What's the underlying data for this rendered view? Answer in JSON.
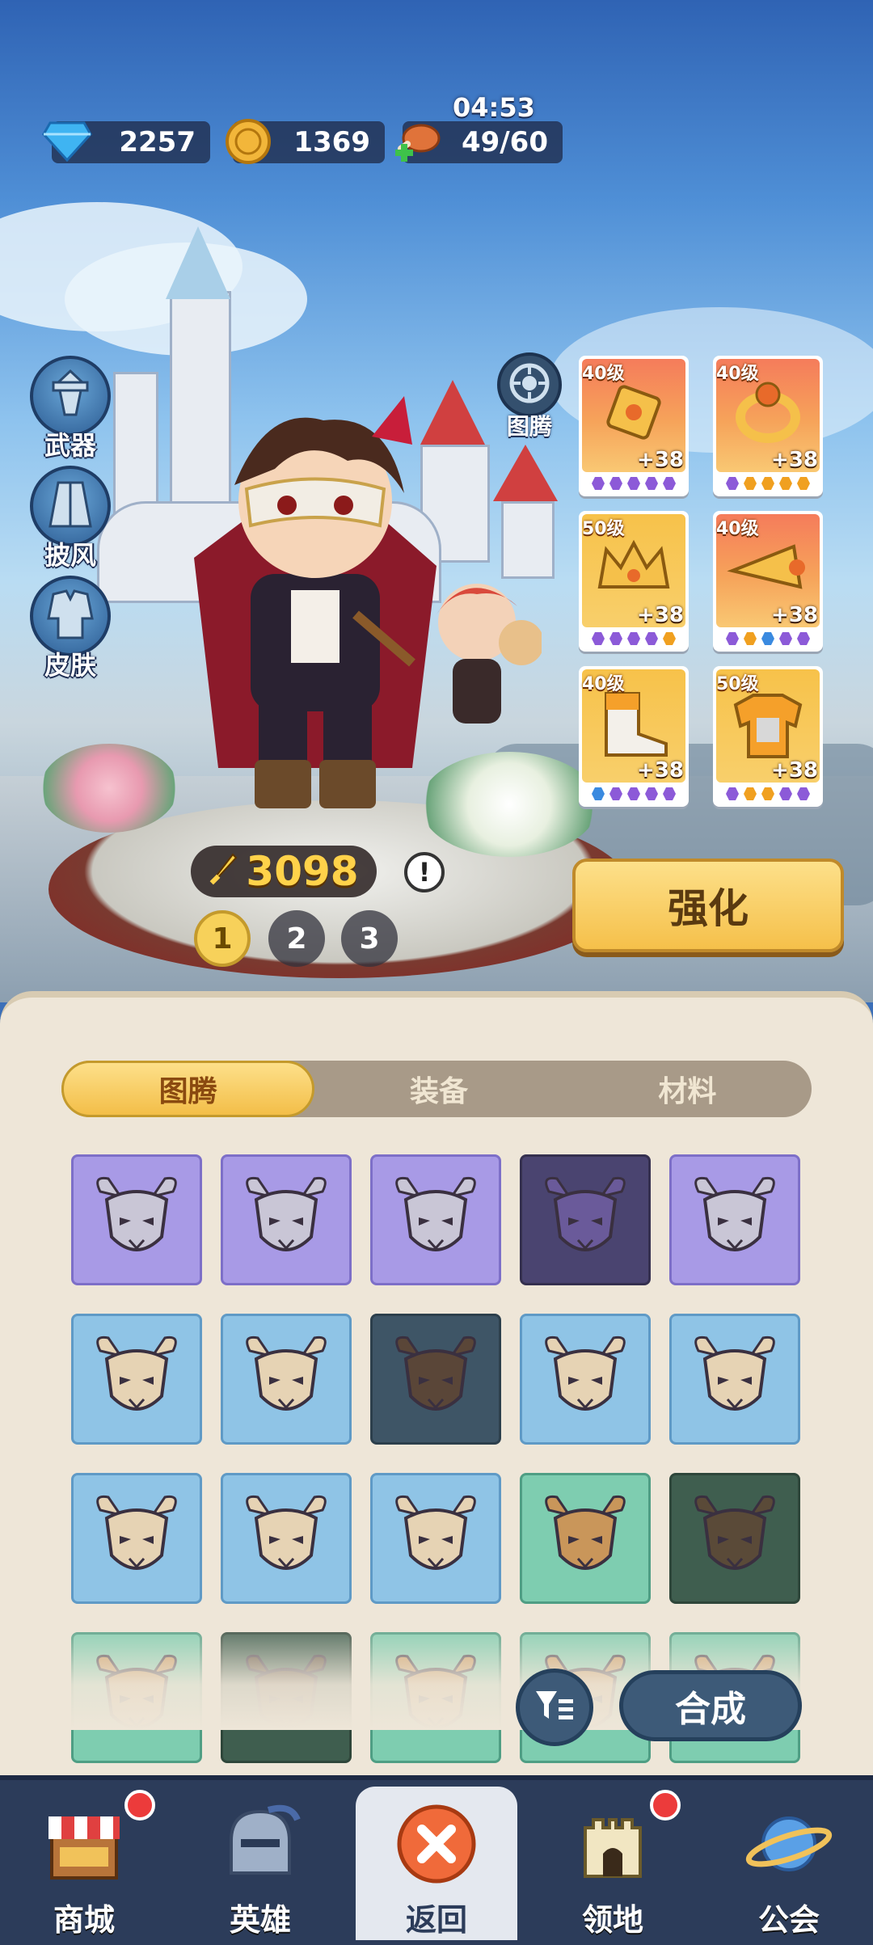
{
  "currency": {
    "gems": "2257",
    "coins": "1369",
    "stamina": "49/60",
    "timer": "04:53"
  },
  "side_buttons": [
    {
      "label": "武器",
      "icon": "weapon-icon"
    },
    {
      "label": "披风",
      "icon": "cape-icon"
    },
    {
      "label": "皮肤",
      "icon": "skin-icon"
    }
  ],
  "totem": {
    "label": "图腾",
    "icon": "totem-icon"
  },
  "hero": {
    "power": "3098",
    "pages": [
      "1",
      "2",
      "3"
    ],
    "active_page": "1"
  },
  "equipment": [
    {
      "level": "40级",
      "plus": "+38",
      "dots": [
        "p",
        "p",
        "p",
        "p",
        "p"
      ],
      "style": "red"
    },
    {
      "level": "40级",
      "plus": "+38",
      "dots": [
        "p",
        "o",
        "o",
        "o",
        "o"
      ],
      "style": "red"
    },
    {
      "level": "50级",
      "plus": "+38",
      "dots": [
        "p",
        "p",
        "p",
        "p",
        "o"
      ],
      "style": "gold"
    },
    {
      "level": "40级",
      "plus": "+38",
      "dots": [
        "p",
        "o",
        "b",
        "p",
        "p"
      ],
      "style": "red"
    },
    {
      "level": "40级",
      "plus": "+38",
      "dots": [
        "b",
        "p",
        "p",
        "p",
        "p"
      ],
      "style": "gold"
    },
    {
      "level": "50级",
      "plus": "+38",
      "dots": [
        "p",
        "o",
        "o",
        "p",
        "p"
      ],
      "style": "gold"
    }
  ],
  "enhance_label": "强化",
  "tabs": {
    "totem": "图腾",
    "equipment": "装备",
    "material": "材料",
    "active": "totem"
  },
  "grid": [
    [
      "purple",
      "purple",
      "purple",
      "purple-d",
      "purple"
    ],
    [
      "blue",
      "blue",
      "blue-d",
      "blue",
      "blue"
    ],
    [
      "blue",
      "blue",
      "blue",
      "green",
      "green-d"
    ],
    [
      "green",
      "green-d",
      "green",
      "green",
      "green"
    ]
  ],
  "compose_label": "合成",
  "nav": [
    {
      "label": "商城",
      "icon": "shop-icon",
      "badge": true
    },
    {
      "label": "英雄",
      "icon": "helmet-icon",
      "badge": false
    },
    {
      "label": "返回",
      "icon": "close-icon",
      "badge": false
    },
    {
      "label": "领地",
      "icon": "castle-icon",
      "badge": true
    },
    {
      "label": "公会",
      "icon": "planet-icon",
      "badge": false
    }
  ],
  "colors": {
    "accent_gold": "#f5c04a",
    "badge_red": "#ec3b3b",
    "nav_bg": "#2c3c5a"
  }
}
